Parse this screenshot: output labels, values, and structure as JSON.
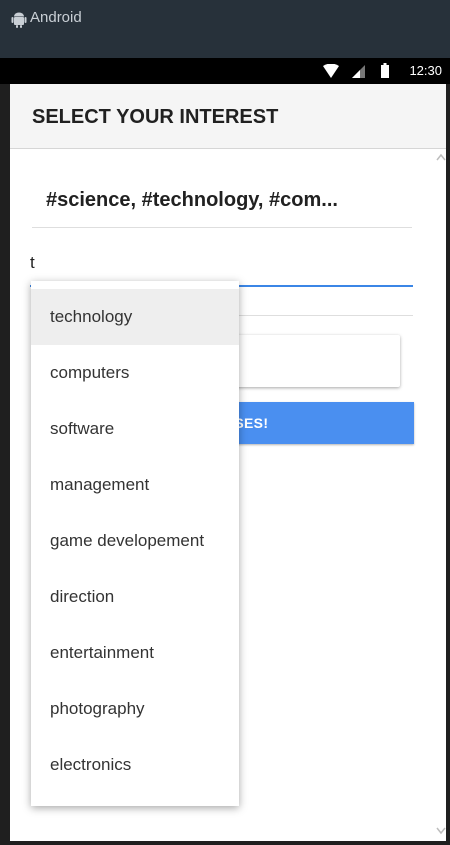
{
  "window": {
    "title": "Android"
  },
  "status_bar": {
    "time": "12:30",
    "icons": [
      "wifi-icon",
      "signal-icon",
      "battery-icon"
    ]
  },
  "app_bar": {
    "title": "SELECT YOUR INTEREST"
  },
  "interests": {
    "selected_text": "#science, #technology, #com..."
  },
  "search": {
    "value": "t"
  },
  "button": {
    "label": "RSES!"
  },
  "dropdown": {
    "selected_index": 0,
    "items": [
      "technology",
      "computers",
      "software",
      "management",
      "game developement",
      "direction",
      "entertainment",
      "photography",
      "electronics"
    ]
  },
  "colors": {
    "accent": "#4a8ff0",
    "input_underline": "#3b86e6",
    "window_bar": "#27313a",
    "status_bar": "#000000",
    "app_bar": "#f5f5f5"
  }
}
